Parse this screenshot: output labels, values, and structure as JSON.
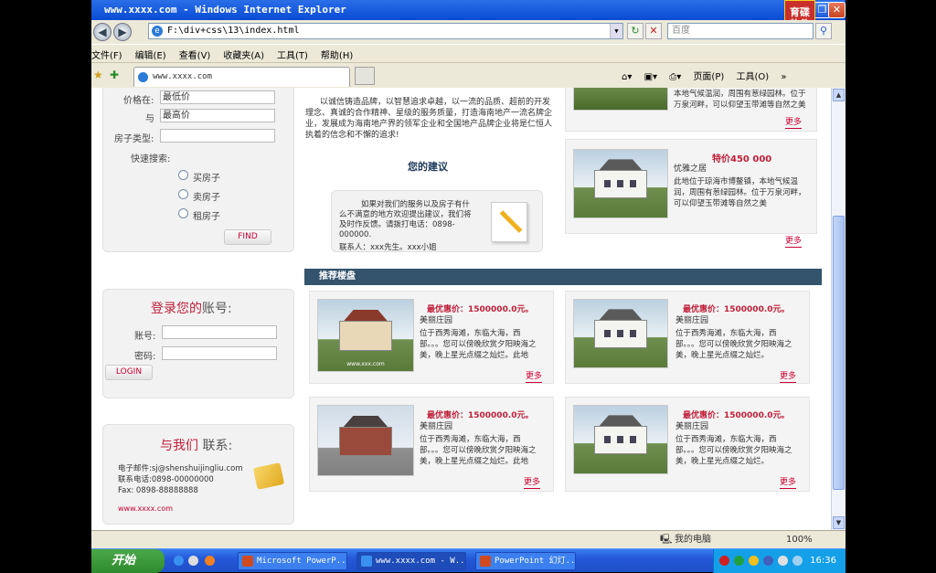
{
  "window": {
    "title": "www.xxxx.com - Windows Internet Explorer",
    "logo_line1": "育碟",
    "logo_line2": "软件"
  },
  "address": {
    "url": "F:\\div+css\\13\\index.html",
    "search_placeholder": "百度"
  },
  "menu": [
    "文件(F)",
    "编辑(E)",
    "查看(V)",
    "收藏夹(A)",
    "工具(T)",
    "帮助(H)"
  ],
  "tab": {
    "label": "www.xxxx.com"
  },
  "toolbar": {
    "page": "页面(P)",
    "tools": "工具(O)",
    "more": "»"
  },
  "search_form": {
    "price_from_label": "价格在:",
    "price_from_value": "最低价",
    "price_to_label": "与",
    "price_to_value": "最高价",
    "type_label": "房子类型:",
    "quick_label": "快速搜索:",
    "radios": [
      "买房子",
      "卖房子",
      "租房子"
    ],
    "find": "FIND"
  },
  "login": {
    "title_a": "登录您的",
    "title_b": "账号:",
    "account": "账号:",
    "password": "密码:",
    "button": "LOGIN"
  },
  "contact": {
    "title_a": "与我们",
    "title_b": "联系:",
    "email": "电子邮件:sj@shenshuijingliu.com",
    "phone": "联系电话:0898-00000000",
    "fax": "Fax: 0898-88888888",
    "site": "www.xxxx.com"
  },
  "intro": {
    "text": "以诚信铸造品牌，以智慧追求卓越，以一流的品质、超前的开发理念、真诚的合作精神、星级的服务质量，打造海南地产一流名牌企业，发展成为海南地产界的领军企业和全国地产品牌企业将是仁恒人执着的信念和不懈的追求!"
  },
  "suggest": {
    "title": "您的建议",
    "text": "如果对我们的服务以及房子有什么不满意的地方欢迎提出建议，我们将及时作反馈。请拨打电话：0898-000000.",
    "contact": "联系人：xxx先生。xxx小姐"
  },
  "side_top": {
    "text": "本地气候温润，周围有葱绿园林。位于万泉河畔，可以仰望玉带滩等自然之美",
    "more": "更多"
  },
  "side_mid": {
    "price": "特价450 000",
    "name": "忧雅之居",
    "text": "此地位于琼海市博鳌镇，本地气候温润，周围有葱绿园林。位于万泉河畔，可以仰望玉带滩等自然之美",
    "more": "更多"
  },
  "recommend": {
    "title": "推荐楼盘",
    "cards": [
      {
        "price": "最优惠价：1500000.0元。",
        "name": "美丽庄园",
        "text": "位于西秀海滩，东临大海，西部。。。您可以傍晚欣赏夕阳映海之美，晚上星光点缀之灿烂。此地",
        "more": "更多",
        "caption": "www.xxx.com"
      },
      {
        "price": "最优惠价：1500000.0元。",
        "name": "美丽庄园",
        "text": "位于西秀海滩，东临大海，西部。。。您可以傍晚欣赏夕阳映海之美，晚上星光点缀之灿烂。",
        "more": "更多"
      },
      {
        "price": "最优惠价：1500000.0元。",
        "name": "美丽庄园",
        "text": "位于西秀海滩，东临大海，西部。。。您可以傍晚欣赏夕阳映海之美，晚上星光点缀之灿烂。此地",
        "more": "更多"
      },
      {
        "price": "最优惠价：1500000.0元。",
        "name": "美丽庄园",
        "text": "位于西秀海滩，东临大海，西部。。。您可以傍晚欣赏夕阳映海之美，晚上星光点缀之灿烂。",
        "more": "更多"
      }
    ]
  },
  "status": {
    "zone": "我的电脑",
    "zoom": "100%"
  },
  "taskbar": {
    "start": "开始",
    "tasks": [
      "Microsoft PowerP...",
      "www.xxxx.com - W...",
      "PowerPoint 幻灯..."
    ],
    "clock": "16:36"
  },
  "colors": {
    "accent": "#c0203a",
    "bar": "#34546e",
    "titlebar": "#0a4bd4",
    "taskbar": "#2458d8"
  }
}
